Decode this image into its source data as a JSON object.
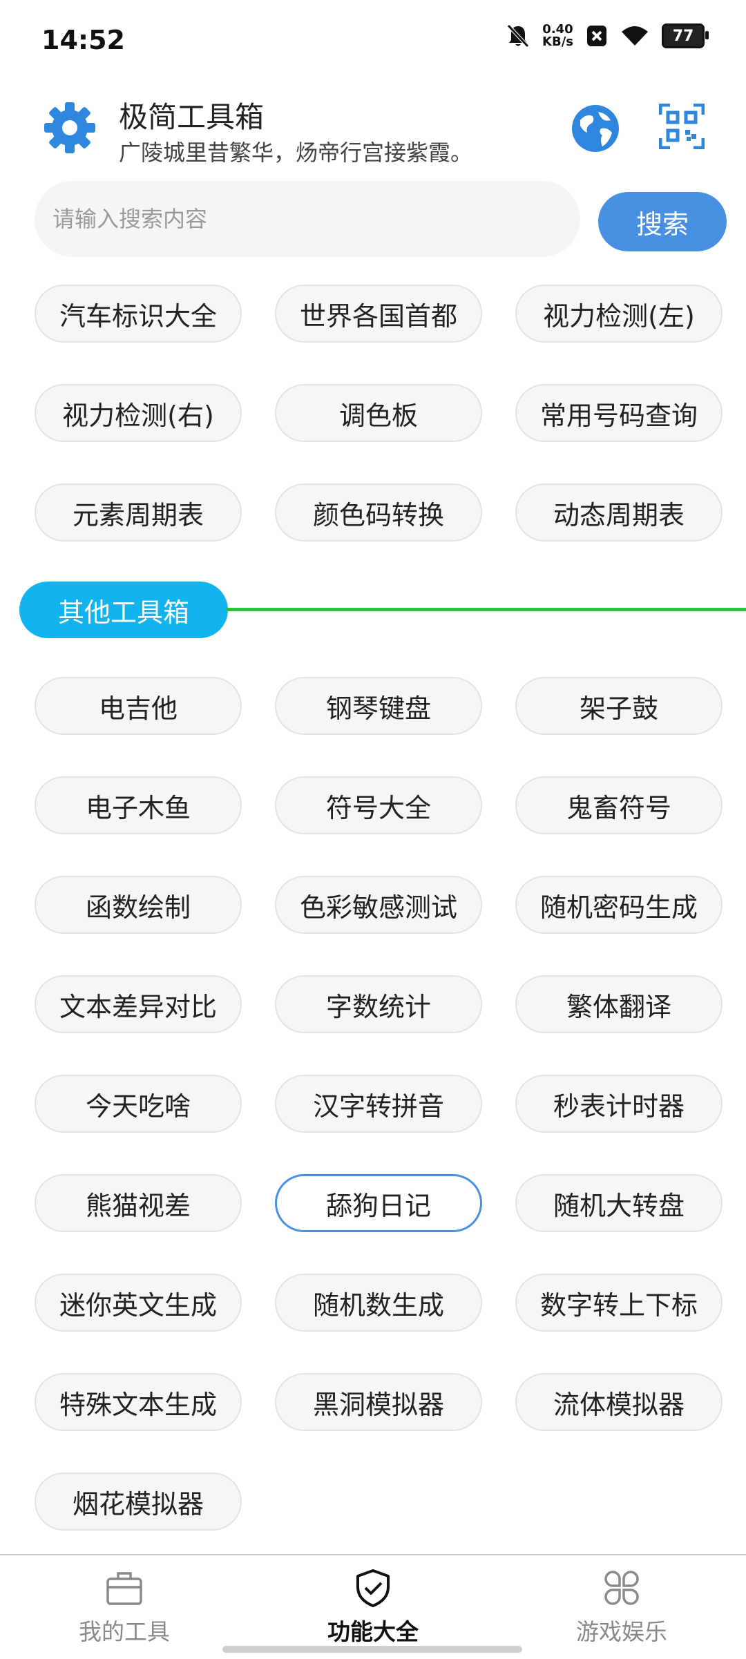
{
  "status_bar": {
    "time": "14:52",
    "net_speed_value": "0.40",
    "net_speed_unit": "KB/s",
    "battery": "77",
    "icons": [
      "mute-bell-icon",
      "close-badge-icon",
      "wifi-icon",
      "battery-icon"
    ]
  },
  "header": {
    "title": "极简工具箱",
    "subtitle": "广陵城里昔繁华，炀帝行宫接紫霞。",
    "icons": [
      "gear-icon",
      "globe-icon",
      "qr-scan-icon"
    ]
  },
  "search": {
    "placeholder": "请输入搜索内容",
    "button_label": "搜索"
  },
  "top_tools": [
    "汽车标识大全",
    "世界各国首都",
    "视力检测(左)",
    "视力检测(右)",
    "调色板",
    "常用号码查询",
    "元素周期表",
    "颜色码转换",
    "动态周期表"
  ],
  "section": {
    "title": "其他工具箱"
  },
  "other_tools": [
    "电吉他",
    "钢琴键盘",
    "架子鼓",
    "电子木鱼",
    "符号大全",
    "鬼畜符号",
    "函数绘制",
    "色彩敏感测试",
    "随机密码生成",
    "文本差异对比",
    "字数统计",
    "繁体翻译",
    "今天吃啥",
    "汉字转拼音",
    "秒表计时器",
    "熊猫视差",
    "舔狗日记",
    "随机大转盘",
    "迷你英文生成",
    "随机数生成",
    "数字转上下标",
    "特殊文本生成",
    "黑洞模拟器",
    "流体模拟器",
    "烟花模拟器"
  ],
  "bottom_nav": {
    "items": [
      {
        "label": "我的工具",
        "icon": "toolbox-icon"
      },
      {
        "label": "功能大全",
        "icon": "shield-check-icon"
      },
      {
        "label": "游戏娱乐",
        "icon": "grid-apps-icon"
      }
    ],
    "active_index": 1
  },
  "colors": {
    "accent_blue": "#4a90e2",
    "section_pill": "#12b4ef",
    "section_line": "#35c03b",
    "gear": "#2f86de"
  }
}
